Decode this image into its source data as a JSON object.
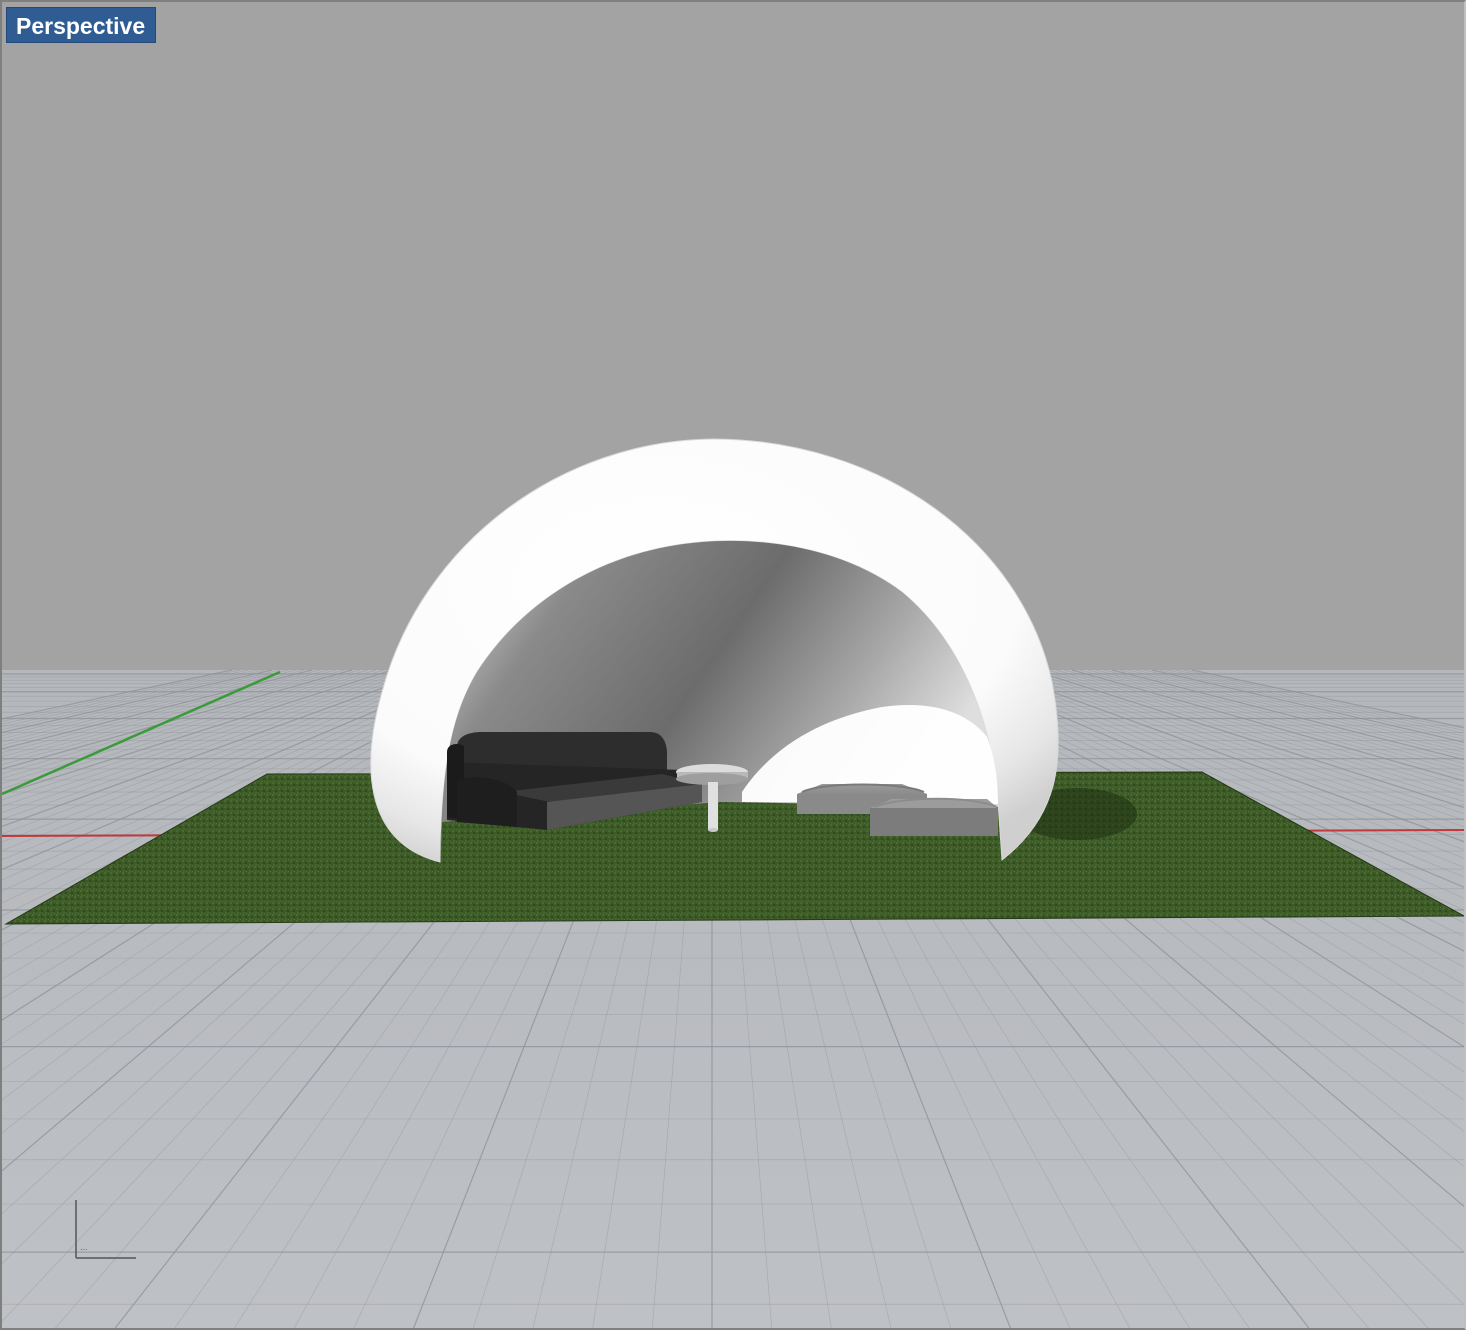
{
  "viewport": {
    "title": "Perspective",
    "background": "#a3a3a3",
    "grid_color": "#b9bcc0",
    "grid_line_color": "#8e9297",
    "x_axis_color": "#c0393b",
    "y_axis_color": "#3b9a3b",
    "tab_color": "#2f5d93"
  },
  "scene": {
    "objects": [
      "dome-shell",
      "grass-ground-plane",
      "sofa",
      "round-table",
      "ottoman-left",
      "ottoman-right"
    ],
    "grass_color": "#3c5a26",
    "dome_color": "#ffffff",
    "sofa_color": "#2a2a2a"
  },
  "axis_widget": {
    "label": "..."
  }
}
